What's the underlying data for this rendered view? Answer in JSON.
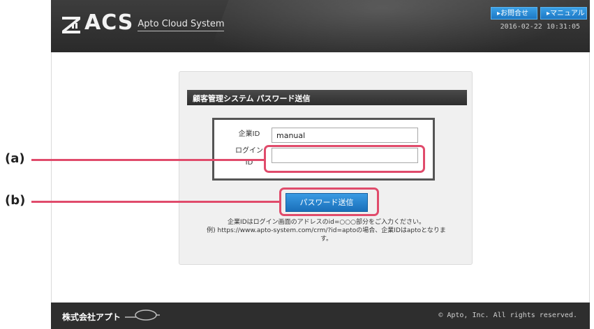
{
  "header": {
    "logo_text": "ACS",
    "logo_subtitle": "Apto Cloud System",
    "contact_button": "▸お問合せ",
    "manual_button": "▸マニュアル",
    "timestamp": "2016-02-22 10:31:05"
  },
  "card": {
    "title": "顧客管理システム パスワード送信",
    "company_id_label": "企業ID",
    "company_id_value": "manual",
    "login_id_label_line1": "ログイン",
    "login_id_label_line2": "ID",
    "login_id_value": "",
    "submit_label": "パスワード送信",
    "help_line1": "企業IDはログイン画面のアドレスのid=○○○部分をご入力ください。",
    "help_line2": "例) https://www.apto-system.com/crm/?id=aptoの場合、企業IDはaptoとなりま",
    "help_line3": "す。"
  },
  "footer": {
    "company": "株式会社アプト",
    "copyright": "© Apto, Inc. All rights reserved."
  },
  "annotations": {
    "a_label": "(a)",
    "b_label": "(b)",
    "color": "#e04b6b"
  },
  "icons": [
    "acs-logo-icon",
    "apto-footer-logo-icon"
  ]
}
